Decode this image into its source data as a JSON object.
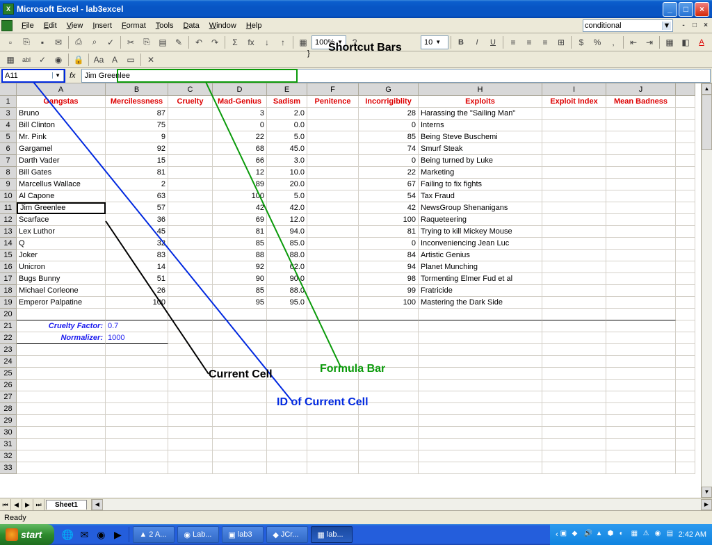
{
  "window": {
    "title": "Microsoft Excel - lab3excel"
  },
  "menus": [
    "File",
    "Edit",
    "View",
    "Insert",
    "Format",
    "Tools",
    "Data",
    "Window",
    "Help"
  ],
  "menubar_combo": "conditional",
  "zoom": "100%",
  "font_size": "10",
  "namebox": "A11",
  "formula": "Jim Greenlee",
  "columns": [
    "A",
    "B",
    "C",
    "D",
    "E",
    "F",
    "G",
    "H",
    "I",
    "J"
  ],
  "headers": {
    "A": "Gangstas",
    "B": "Mercilessness",
    "C": "Cruelty",
    "D": "Mad-Genius",
    "E": "Sadism",
    "F": "Penitence",
    "G": "Incorrigiblity",
    "H": "Exploits",
    "I": "Exploit Index",
    "J": "Mean Badness"
  },
  "rows": [
    {
      "n": 3,
      "A": "Bruno",
      "B": "87",
      "D": "3",
      "E": "2.0",
      "G": "28",
      "H": "Harassing the \"Sailing Man\""
    },
    {
      "n": 4,
      "A": "Bill Clinton",
      "B": "75",
      "D": "0",
      "E": "0.0",
      "G": "0",
      "H": "Interns"
    },
    {
      "n": 5,
      "A": "Mr. Pink",
      "B": "9",
      "D": "22",
      "E": "5.0",
      "G": "85",
      "H": "Being Steve Buschemi"
    },
    {
      "n": 6,
      "A": "Gargamel",
      "B": "92",
      "D": "68",
      "E": "45.0",
      "G": "74",
      "H": "Smurf Steak"
    },
    {
      "n": 7,
      "A": "Darth Vader",
      "B": "15",
      "D": "66",
      "E": "3.0",
      "G": "0",
      "H": "Being turned by Luke"
    },
    {
      "n": 8,
      "A": "Bill Gates",
      "B": "81",
      "D": "12",
      "E": "10.0",
      "G": "22",
      "H": "Marketing"
    },
    {
      "n": 9,
      "A": "Marcellus Wallace",
      "B": "2",
      "D": "89",
      "E": "20.0",
      "G": "67",
      "H": "Failing to fix fights"
    },
    {
      "n": 10,
      "A": "Al Capone",
      "B": "63",
      "D": "100",
      "E": "5.0",
      "G": "54",
      "H": "Tax Fraud"
    },
    {
      "n": 11,
      "A": "Jim Greenlee",
      "B": "57",
      "D": "42",
      "E": "42.0",
      "G": "42",
      "H": "NewsGroup Shenanigans"
    },
    {
      "n": 12,
      "A": "Scarface",
      "B": "36",
      "D": "69",
      "E": "12.0",
      "G": "100",
      "H": "Raqueteering"
    },
    {
      "n": 13,
      "A": "Lex Luthor",
      "B": "45",
      "D": "81",
      "E": "94.0",
      "G": "81",
      "H": "Trying to kill Mickey Mouse"
    },
    {
      "n": 14,
      "A": "Q",
      "B": "32",
      "D": "85",
      "E": "85.0",
      "G": "0",
      "H": "Inconveniencing Jean Luc"
    },
    {
      "n": 15,
      "A": "Joker",
      "B": "83",
      "D": "88",
      "E": "88.0",
      "G": "84",
      "H": "Artistic Genius"
    },
    {
      "n": 16,
      "A": "Unicron",
      "B": "14",
      "D": "92",
      "E": "62.0",
      "G": "94",
      "H": "Planet Munching"
    },
    {
      "n": 17,
      "A": "Bugs Bunny",
      "B": "51",
      "D": "90",
      "E": "90.0",
      "G": "98",
      "H": "Tormenting Elmer Fud et al"
    },
    {
      "n": 18,
      "A": "Michael Corleone",
      "B": "26",
      "D": "85",
      "E": "88.0",
      "G": "99",
      "H": "Fratricide"
    },
    {
      "n": 19,
      "A": "Emperor Palpatine",
      "B": "100",
      "D": "95",
      "E": "95.0",
      "G": "100",
      "H": "Mastering the Dark Side"
    }
  ],
  "params": [
    {
      "n": 21,
      "label": "Cruelty Factor:",
      "value": "0.7"
    },
    {
      "n": 22,
      "label": "Normalizer:",
      "value": "1000"
    }
  ],
  "empty_rows": [
    20,
    23,
    24,
    25,
    26,
    27,
    28,
    29,
    30,
    31,
    32,
    33
  ],
  "sheet_tab": "Sheet1",
  "status": "Ready",
  "taskbar": {
    "start": "start",
    "tasks": [
      {
        "label": "2 A...",
        "icon": "▲"
      },
      {
        "label": "Lab...",
        "icon": "◉"
      },
      {
        "label": "lab3",
        "icon": "▣"
      },
      {
        "label": "JCr...",
        "icon": "◆"
      },
      {
        "label": "lab...",
        "icon": "▦",
        "active": true
      }
    ],
    "clock": "2:42 AM"
  },
  "annotations": {
    "shortcut": "Shortcut Bars",
    "formula": "Formula Bar",
    "current": "Current Cell",
    "id": "ID of Current Cell"
  }
}
